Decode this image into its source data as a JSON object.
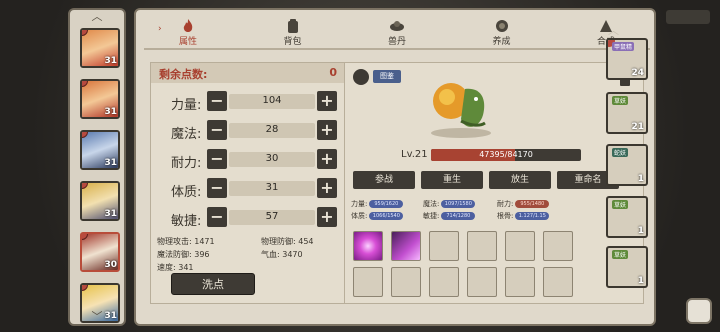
{
  "tabs": [
    {
      "label": "属性",
      "icon": "flame-icon",
      "active": true
    },
    {
      "label": "背包",
      "icon": "backpack-icon"
    },
    {
      "label": "兽丹",
      "icon": "pill-icon"
    },
    {
      "label": "养成",
      "icon": "cultivate-icon"
    },
    {
      "label": "合成",
      "icon": "synthesis-icon"
    }
  ],
  "points": {
    "label": "剩余点数:",
    "value": "0"
  },
  "attributes": [
    {
      "name": "力量:",
      "value": "104"
    },
    {
      "name": "魔法:",
      "value": "28"
    },
    {
      "name": "耐力:",
      "value": "30"
    },
    {
      "name": "体质:",
      "value": "31"
    },
    {
      "name": "敏捷:",
      "value": "57"
    }
  ],
  "derived": {
    "phys_atk": "物理攻击: 1471",
    "phys_def": "物理防御: 454",
    "magic_def": "魔法防御: 396",
    "qi_blood": "气血: 3470",
    "speed": "速度: 341"
  },
  "assign_button": "洗点",
  "pet": {
    "list_btn": "图鉴",
    "level": "Lv.21",
    "xp": "47395/84170",
    "xp_fraction": 0.563,
    "actions": [
      "参战",
      "重生",
      "放生",
      "重命名"
    ],
    "stats": [
      {
        "label": "力量:",
        "bar": "959/1620"
      },
      {
        "label": "魔法:",
        "bar": "1097/1580"
      },
      {
        "label": "耐力:",
        "bar": "955/1480"
      },
      {
        "label": "体质:",
        "bar": "1066/1540"
      },
      {
        "label": "敏捷:",
        "bar": "714/1280"
      },
      {
        "label": "根骨:",
        "bar": "1.127/1.15"
      }
    ]
  },
  "roster": {
    "levels": [
      "31",
      "31",
      "31",
      "31",
      "30",
      "31"
    ]
  },
  "monsters": [
    {
      "tag": "甲鼠精",
      "level": "24"
    },
    {
      "tag": "草妖",
      "level": "21"
    },
    {
      "tag": "蛇妖",
      "level": "1"
    },
    {
      "tag": "草妖",
      "level": "1"
    },
    {
      "tag": "草妖",
      "level": "1"
    }
  ]
}
